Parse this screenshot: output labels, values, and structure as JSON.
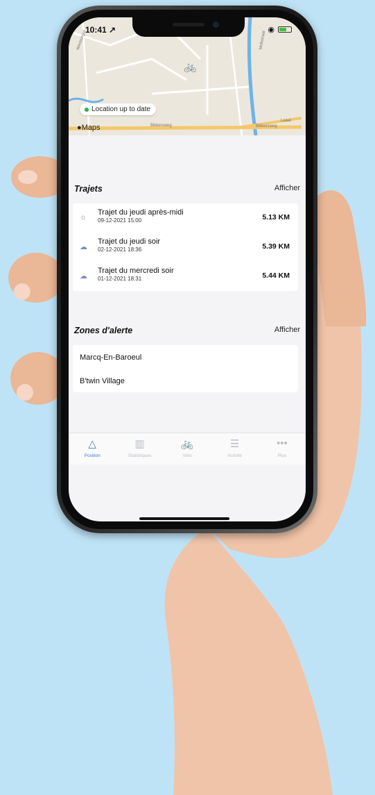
{
  "status_bar": {
    "time": "10:41 ↗"
  },
  "map": {
    "location_status": "Location up to date",
    "attribution": "Maps",
    "streets": [
      "Westsingel",
      "Melkstraat",
      "Bikkersweg",
      "Bikkersweg",
      "Laaal"
    ]
  },
  "trajets": {
    "title": "Trajets",
    "link": "Afficher",
    "items": [
      {
        "icon": "sun-icon",
        "name": "Trajet du jeudi après-midi",
        "date": "09-12-2021 15:00",
        "distance": "5.13 KM"
      },
      {
        "icon": "cloud-icon",
        "name": "Trajet du jeudi soir",
        "date": "02-12-2021 18:36",
        "distance": "5.39 KM"
      },
      {
        "icon": "cloud-icon",
        "name": "Trajet du mercredi soir",
        "date": "01-12-2021 18:31",
        "distance": "5.44 KM"
      }
    ]
  },
  "zones": {
    "title": "Zones d'alerte",
    "link": "Afficher",
    "items": [
      "Marcq-En-Baroeul",
      "B'twin Village"
    ]
  },
  "tabbar": {
    "tabs": [
      {
        "label": "Position",
        "icon": "navigation-arrow-icon",
        "active": true
      },
      {
        "label": "Statistiques",
        "icon": "bar-chart-icon",
        "active": false
      },
      {
        "label": "Vélo",
        "icon": "bicycle-icon",
        "active": false
      },
      {
        "label": "Activité",
        "icon": "list-lines-icon",
        "active": false
      },
      {
        "label": "Plus",
        "icon": "more-dots-icon",
        "active": false
      }
    ]
  },
  "colors": {
    "accent": "#3e7cd6",
    "background": "#bfe3f6",
    "location_dot": "#2bb24c"
  }
}
